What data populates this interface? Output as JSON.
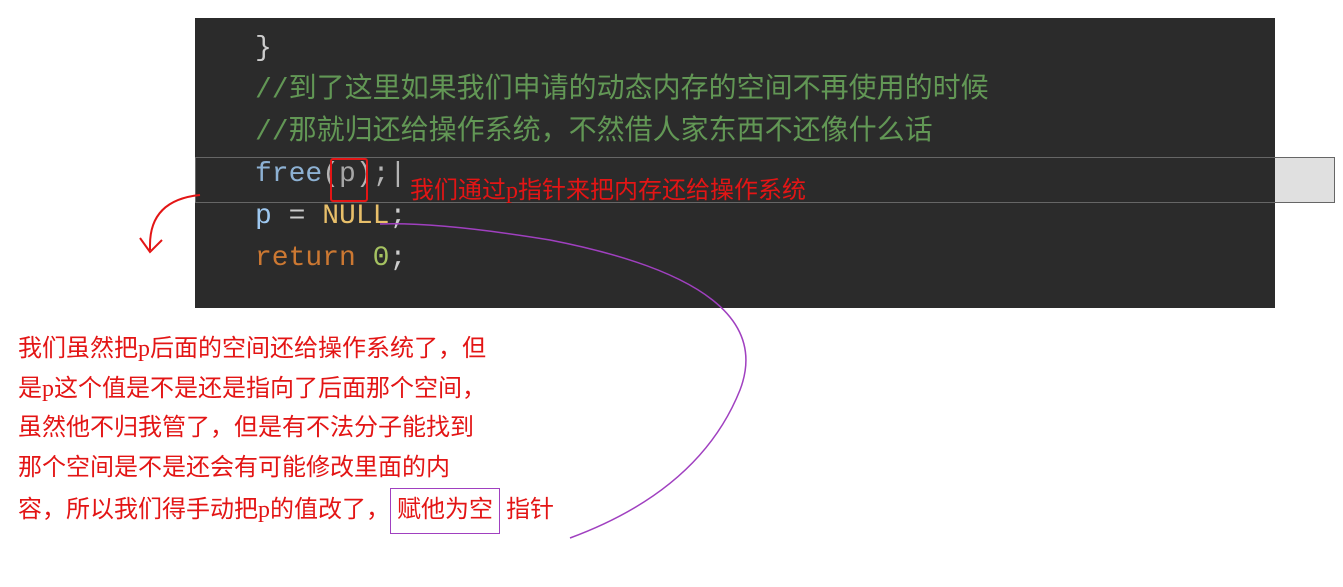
{
  "code": {
    "brace_close": "}",
    "comment1": "//到了这里如果我们申请的动态内存的空间不再使用的时候",
    "comment2": "//那就归还给操作系统，不然借人家东西不还像什么话",
    "free_call": "free",
    "free_paren_open": "(",
    "free_arg": "p",
    "free_paren_close": ")",
    "free_semi": ";",
    "assign_lhs": "p",
    "assign_op": " = ",
    "assign_rhs": "NULL",
    "assign_semi": ";",
    "return_kw": "return",
    "return_val": " 0",
    "return_semi": ";"
  },
  "annotation": {
    "inline": "我们通过p指针来把内存还给操作系统",
    "block_line1": "我们虽然把p后面的空间还给操作系统了，但",
    "block_line2": "是p这个值是不是还是指向了后面那个空间，",
    "block_line3": "虽然他不归我管了，但是有不法分子能找到",
    "block_line4": "那个空间是不是还会有可能修改里面的内",
    "block_line5_prefix": "容，所以我们得手动把p的值改了，",
    "block_line5_box": "赋他为空",
    "block_line5_suffix": " 指针"
  }
}
